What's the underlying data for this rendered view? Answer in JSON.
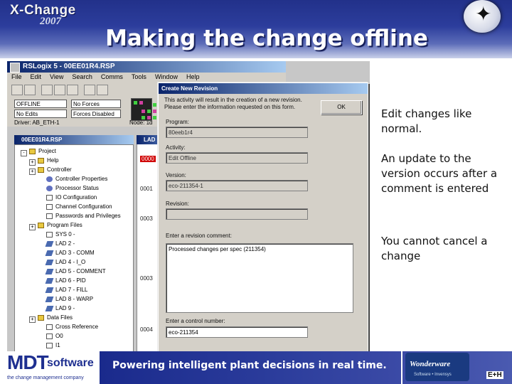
{
  "slide": {
    "logo_main": "X-Change",
    "logo_year": "2007",
    "title": "Making the change offline"
  },
  "app": {
    "window_title": "RSLogix 5 - 00EE01R4.RSP",
    "menu": [
      "File",
      "Edit",
      "View",
      "Search",
      "Comms",
      "Tools",
      "Window",
      "Help"
    ],
    "mode": "OFFLINE",
    "forces": "No Forces",
    "edits": "No Edits",
    "forces_state": "Forces Disabled",
    "driver_label": "Driver: AB_ETH-1",
    "node_label": "Node: 1d",
    "project_title": "00EE01R4.RSP",
    "ladder_title": "LAD",
    "tree": [
      {
        "label": "Project",
        "kind": "folder",
        "level": 0
      },
      {
        "label": "Help",
        "kind": "folder",
        "level": 1
      },
      {
        "label": "Controller",
        "kind": "folder",
        "level": 1
      },
      {
        "label": "Controller Properties",
        "kind": "gear",
        "level": 2
      },
      {
        "label": "Processor Status",
        "kind": "gear",
        "level": 2
      },
      {
        "label": "IO Configuration",
        "kind": "file",
        "level": 2
      },
      {
        "label": "Channel Configuration",
        "kind": "file",
        "level": 2
      },
      {
        "label": "Passwords and Privileges",
        "kind": "file",
        "level": 2
      },
      {
        "label": "Program Files",
        "kind": "folder",
        "level": 1
      },
      {
        "label": "SYS 0 -",
        "kind": "file",
        "level": 2
      },
      {
        "label": "LAD 2 -",
        "kind": "ladder",
        "level": 2
      },
      {
        "label": "LAD 3 - COMM",
        "kind": "ladder",
        "level": 2
      },
      {
        "label": "LAD 4 - I_O",
        "kind": "ladder",
        "level": 2
      },
      {
        "label": "LAD 5 - COMMENT",
        "kind": "ladder",
        "level": 2
      },
      {
        "label": "LAD 6 - PID",
        "kind": "ladder",
        "level": 2
      },
      {
        "label": "LAD 7 - FILL",
        "kind": "ladder",
        "level": 2
      },
      {
        "label": "LAD 8 - WARP",
        "kind": "ladder",
        "level": 2
      },
      {
        "label": "LAD 9 -",
        "kind": "ladder",
        "level": 2
      },
      {
        "label": "Data Files",
        "kind": "folder",
        "level": 1
      },
      {
        "label": "Cross Reference",
        "kind": "file",
        "level": 2
      },
      {
        "label": "O0",
        "kind": "file",
        "level": 2
      },
      {
        "label": "I1",
        "kind": "file",
        "level": 2
      }
    ],
    "rungs": [
      "0000",
      "0001",
      "0003",
      "0003",
      "0004"
    ]
  },
  "dialog": {
    "title": "Create New Revision",
    "intro": "This activity will result in the creation of a new revision. Please enter the information requested on this form.",
    "ok_label": "OK",
    "program_label": "Program:",
    "program_value": "80eeb1r4",
    "activity_label": "Activity:",
    "activity_value": "Edit Offline",
    "version_label": "Version:",
    "version_value": "eco-211354-1",
    "revision_label": "Revision:",
    "revision_value": "",
    "comment_label": "Enter a revision comment:",
    "comment_value": "Processed changes per spec (211354)",
    "control_label": "Enter a control number:",
    "control_value": "eco-211354"
  },
  "bullets": [
    "Edit changes like normal.",
    "An update to the version occurs after a comment is entered",
    "You cannot cancel a change"
  ],
  "footer": {
    "mdt_big": "MDT",
    "mdt_small": "software",
    "mdt_tag": "the change management company",
    "tagline": "Powering intelligent plant decisions in real time.",
    "ww_name": "Wonderware",
    "ww_sub": "Software • Invensys",
    "eh": "E+H"
  }
}
